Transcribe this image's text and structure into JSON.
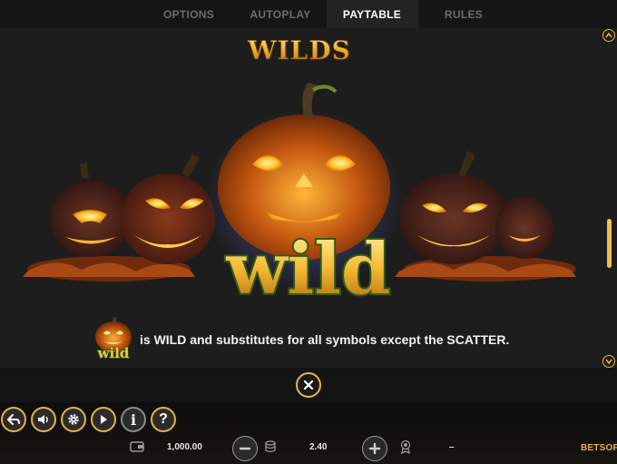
{
  "tabs": [
    {
      "label": "OPTIONS",
      "active": false
    },
    {
      "label": "AUTOPLAY",
      "active": false
    },
    {
      "label": "PAYTABLE",
      "active": true
    },
    {
      "label": "RULES",
      "active": false
    }
  ],
  "section": {
    "title": "WILDS",
    "art_text": "wild",
    "icon_text": "wild",
    "description": "is WILD and substitutes for all symbols except the SCATTER."
  },
  "scrollbar": {
    "position": 0.6
  },
  "controls": {
    "icons": [
      "back-arrow-icon",
      "speaker-icon",
      "gear-icon",
      "play-next-icon",
      "info-icon",
      "help-icon"
    ],
    "info_symbol": "i",
    "help_symbol": "?"
  },
  "status": {
    "balance": "1,000.00",
    "bet": "2.40",
    "win": "–"
  },
  "brand": {
    "logo_prefix": "BET",
    "logo_suffix": "SOFT",
    "accent": "#e8b340"
  }
}
